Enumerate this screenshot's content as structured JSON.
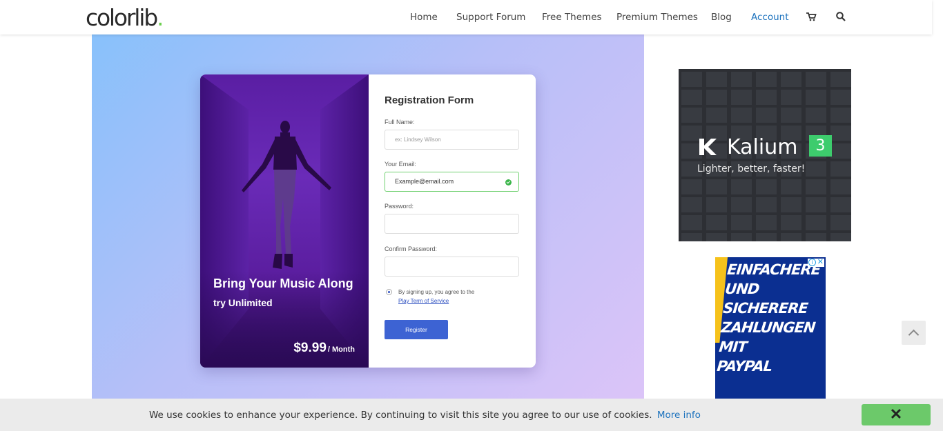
{
  "header": {
    "logo_text": "colorlib",
    "logo_dot": ".",
    "nav": [
      "Home",
      "Support Forum",
      "Free Themes",
      "Premium Themes",
      "Blog",
      "Account"
    ],
    "active_nav": "Account",
    "icons": [
      "cart-icon",
      "search-icon"
    ]
  },
  "promo": {
    "title": "Bring Your Music Along",
    "subtitle": "try Unlimited",
    "price": "$9.99",
    "period": "/ Month"
  },
  "form": {
    "title": "Registration Form",
    "full_name_label": "Full Name:",
    "full_name_placeholder": "ex: Lindsey Wilson",
    "email_label": "Your Email:",
    "email_value": "Example@email.com",
    "password_label": "Password:",
    "confirm_label": "Confirm Password:",
    "agree_text": "By signing up, you agree to the",
    "terms_link": "Play Term of Service",
    "register_button": "Register"
  },
  "ads": {
    "kalium_brand": "Kalium",
    "kalium_version": "3",
    "kalium_tagline": "Lighter, better, faster!",
    "paypal_lines": [
      "EINFACHERE",
      "UND SICHERERE",
      "ZAHLUNGEN MIT",
      "PAYPAL"
    ]
  },
  "cookie": {
    "text": "We use cookies to enhance your experience. By continuing to visit this site you agree to our use of cookies.",
    "more": "More info",
    "close": "✕"
  },
  "colors": {
    "accent_link": "#1e73be",
    "logo_dot": "#6ccf4f",
    "register_button": "#3d63d3",
    "email_valid_border": "#6fd06f",
    "cookie_close": "#6cc96a",
    "kalium_badge": "#3dcc6d",
    "paypal_bg": "#0b2f91"
  }
}
